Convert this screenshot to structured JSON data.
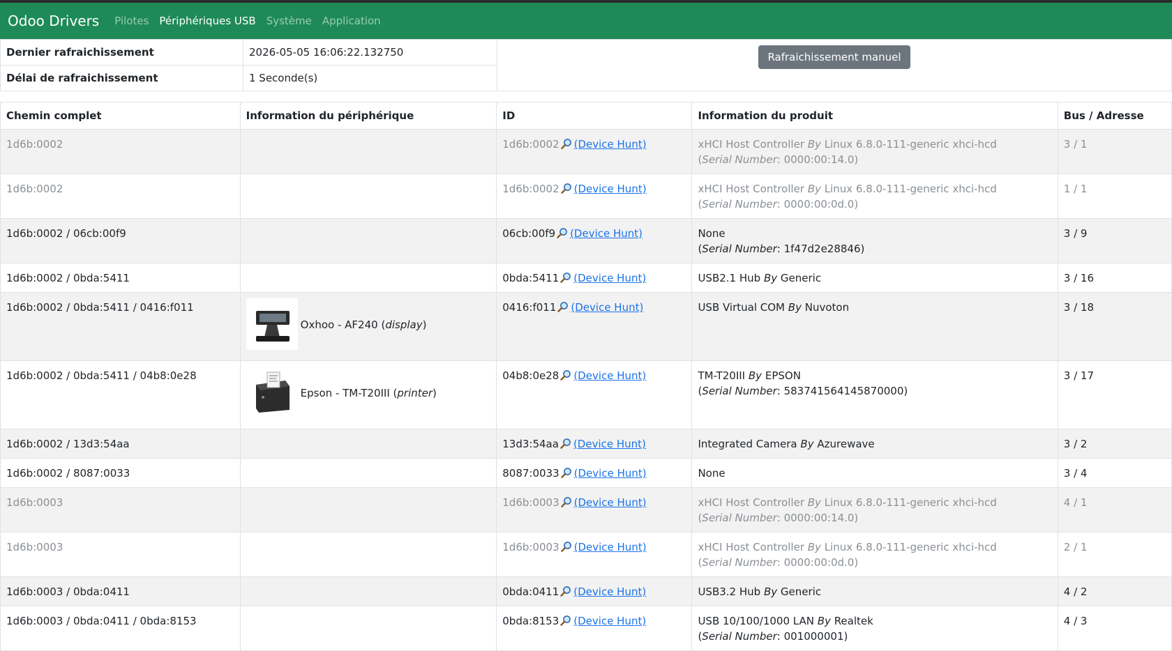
{
  "nav": {
    "brand": "Odoo Drivers",
    "links": [
      "Pilotes",
      "Périphériques USB",
      "Système",
      "Application"
    ]
  },
  "status": {
    "last_refresh_label": "Dernier rafraichissement",
    "last_refresh_value": "2026-05-05 16:06:22.132750",
    "delay_label": "Délai de rafraichissement",
    "delay_value": "1 Seconde(s)",
    "manual_button": "Rafraichissement manuel"
  },
  "table": {
    "headers": [
      "Chemin complet",
      "Information du périphérique",
      "ID",
      "Information du produit",
      "Bus / Adresse"
    ],
    "hunt_label": "(Device Hunt)",
    "by": "By",
    "serial_label": "Serial Number",
    "rows": [
      {
        "path": "1d6b:0002",
        "device": "",
        "device_type": "",
        "id": "1d6b:0002",
        "product": "xHCI Host Controller",
        "vendor": "Linux 6.8.0-111-generic xhci-hcd",
        "serial": "0000:00:14.0",
        "bus": "3 / 1",
        "muted": true
      },
      {
        "path": "1d6b:0002",
        "device": "",
        "device_type": "",
        "id": "1d6b:0002",
        "product": "xHCI Host Controller",
        "vendor": "Linux 6.8.0-111-generic xhci-hcd",
        "serial": "0000:00:0d.0",
        "bus": "1 / 1",
        "muted": true
      },
      {
        "path": "1d6b:0002 / 06cb:00f9",
        "device": "",
        "device_type": "",
        "id": "06cb:00f9",
        "product": "None",
        "vendor": "",
        "serial": "1f47d2e28846",
        "bus": "3 / 9",
        "muted": false
      },
      {
        "path": "1d6b:0002 / 0bda:5411",
        "device": "",
        "device_type": "",
        "id": "0bda:5411",
        "product": "USB2.1 Hub",
        "vendor": "Generic",
        "serial": "",
        "bus": "3 / 16",
        "muted": false
      },
      {
        "path": "1d6b:0002 / 0bda:5411 / 0416:f011",
        "device": "Oxhoo - AF240",
        "device_type": "display",
        "id": "0416:f011",
        "product": "USB Virtual COM",
        "vendor": "Nuvoton",
        "serial": "",
        "bus": "3 / 18",
        "muted": false
      },
      {
        "path": "1d6b:0002 / 0bda:5411 / 04b8:0e28",
        "device": "Epson - TM-T20III",
        "device_type": "printer",
        "id": "04b8:0e28",
        "product": "TM-T20III",
        "vendor": "EPSON",
        "serial": "583741564145870000",
        "bus": "3 / 17",
        "muted": false
      },
      {
        "path": "1d6b:0002 / 13d3:54aa",
        "device": "",
        "device_type": "",
        "id": "13d3:54aa",
        "product": "Integrated Camera",
        "vendor": "Azurewave",
        "serial": "",
        "bus": "3 / 2",
        "muted": false
      },
      {
        "path": "1d6b:0002 / 8087:0033",
        "device": "",
        "device_type": "",
        "id": "8087:0033",
        "product": "None",
        "vendor": "",
        "serial": "",
        "bus": "3 / 4",
        "muted": false
      },
      {
        "path": "1d6b:0003",
        "device": "",
        "device_type": "",
        "id": "1d6b:0003",
        "product": "xHCI Host Controller",
        "vendor": "Linux 6.8.0-111-generic xhci-hcd",
        "serial": "0000:00:14.0",
        "bus": "4 / 1",
        "muted": true
      },
      {
        "path": "1d6b:0003",
        "device": "",
        "device_type": "",
        "id": "1d6b:0003",
        "product": "xHCI Host Controller",
        "vendor": "Linux 6.8.0-111-generic xhci-hcd",
        "serial": "0000:00:0d.0",
        "bus": "2 / 1",
        "muted": true
      },
      {
        "path": "1d6b:0003 / 0bda:0411",
        "device": "",
        "device_type": "",
        "id": "0bda:0411",
        "product": "USB3.2 Hub",
        "vendor": "Generic",
        "serial": "",
        "bus": "4 / 2",
        "muted": false
      },
      {
        "path": "1d6b:0003 / 0bda:0411 / 0bda:8153",
        "device": "",
        "device_type": "",
        "id": "0bda:8153",
        "product": "USB 10/100/1000 LAN",
        "vendor": "Realtek",
        "serial": "001000001",
        "bus": "4 / 3",
        "muted": false
      }
    ]
  },
  "icons": {
    "hunt": "magnifier-icon",
    "display_device": "customer-display-icon",
    "printer_device": "receipt-printer-icon"
  },
  "colors": {
    "navbar": "#1e8a57",
    "link": "#1a73e8",
    "muted_text": "#8a8f94",
    "button": "#6c757d"
  }
}
